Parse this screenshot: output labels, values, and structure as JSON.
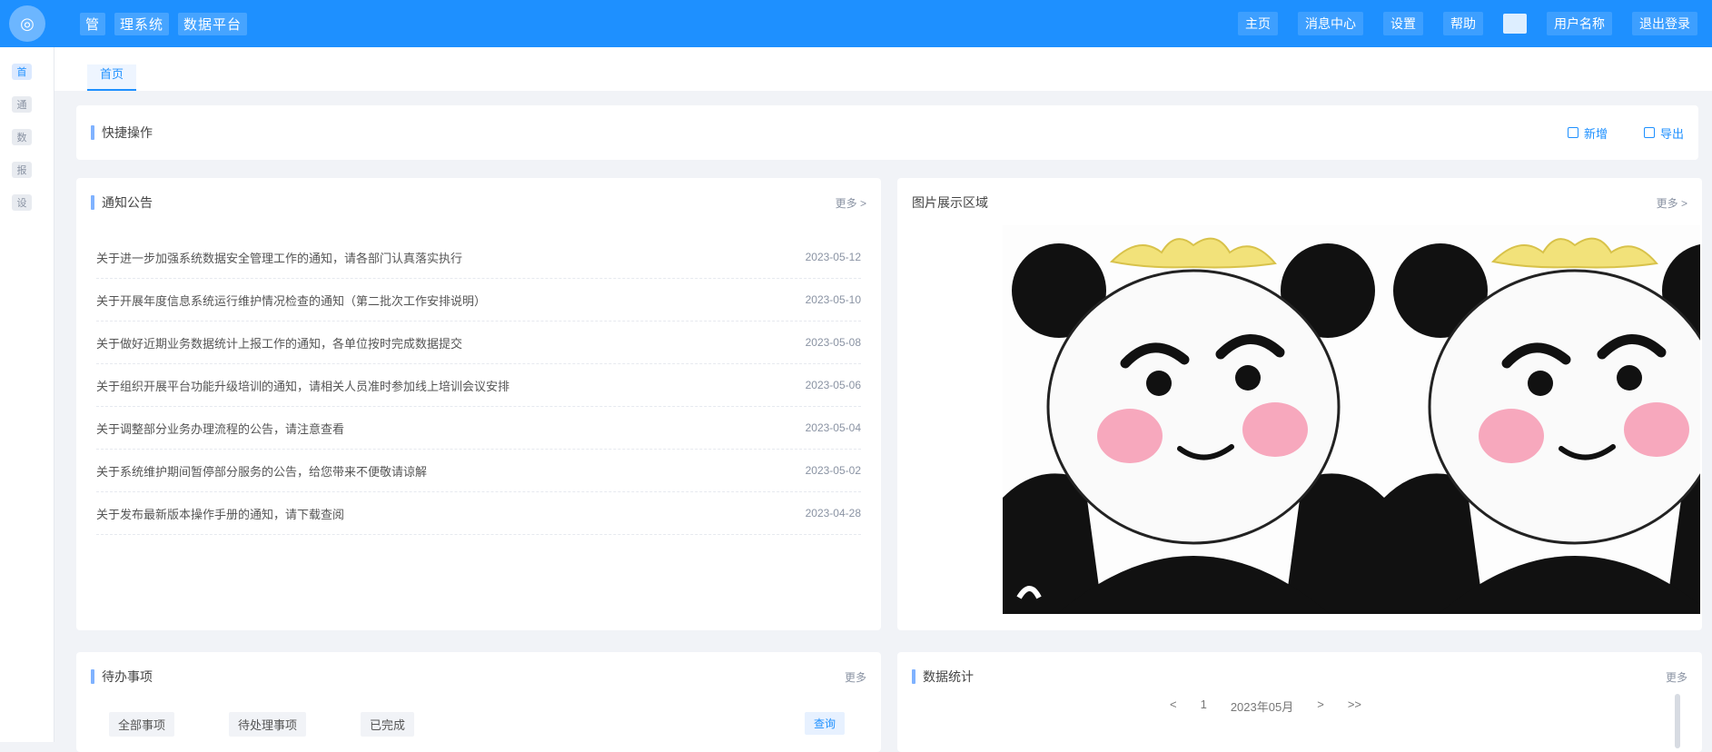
{
  "app": {
    "logo_glyph": "◎",
    "title_parts": [
      "管",
      "理系统",
      "数据平台"
    ],
    "accent": "#1e90ff"
  },
  "topbar": {
    "right_items": [
      "主页",
      "消息中心",
      "设置",
      "帮助",
      "用户名称",
      "退出登录"
    ]
  },
  "rail": {
    "items": [
      "首",
      "通",
      "数",
      "报",
      "设"
    ]
  },
  "tabs": [
    {
      "label": "首页"
    }
  ],
  "toolbar": {
    "title": "快捷操作",
    "buttons": [
      "新增",
      "导出"
    ]
  },
  "news": {
    "title": "通知公告",
    "more": "更多 >",
    "items": [
      {
        "title": "关于进一步加强系统数据安全管理工作的通知，请各部门认真落实执行",
        "date": "2023-05-12"
      },
      {
        "title": "关于开展年度信息系统运行维护情况检查的通知（第二批次工作安排说明）",
        "date": "2023-05-10"
      },
      {
        "title": "关于做好近期业务数据统计上报工作的通知，各单位按时完成数据提交",
        "date": "2023-05-08"
      },
      {
        "title": "关于组织开展平台功能升级培训的通知，请相关人员准时参加线上培训会议安排",
        "date": "2023-05-06"
      },
      {
        "title": "关于调整部分业务办理流程的公告，请注意查看",
        "date": "2023-05-04"
      },
      {
        "title": "关于系统维护期间暂停部分服务的公告，给您带来不便敬请谅解",
        "date": "2023-05-02"
      },
      {
        "title": "关于发布最新版本操作手册的通知，请下载查阅",
        "date": "2023-04-28"
      }
    ]
  },
  "image_panel": {
    "title": "图片展示区域",
    "more": "更多 >"
  },
  "bottom_left": {
    "title": "待办事项",
    "more": "更多",
    "filters": [
      "全部事项",
      "待处理事项",
      "已完成"
    ],
    "action": "查询"
  },
  "bottom_right": {
    "title": "数据统计",
    "more": "更多",
    "pager": [
      "<",
      "1",
      "2023年05月",
      ">",
      ">>"
    ]
  }
}
